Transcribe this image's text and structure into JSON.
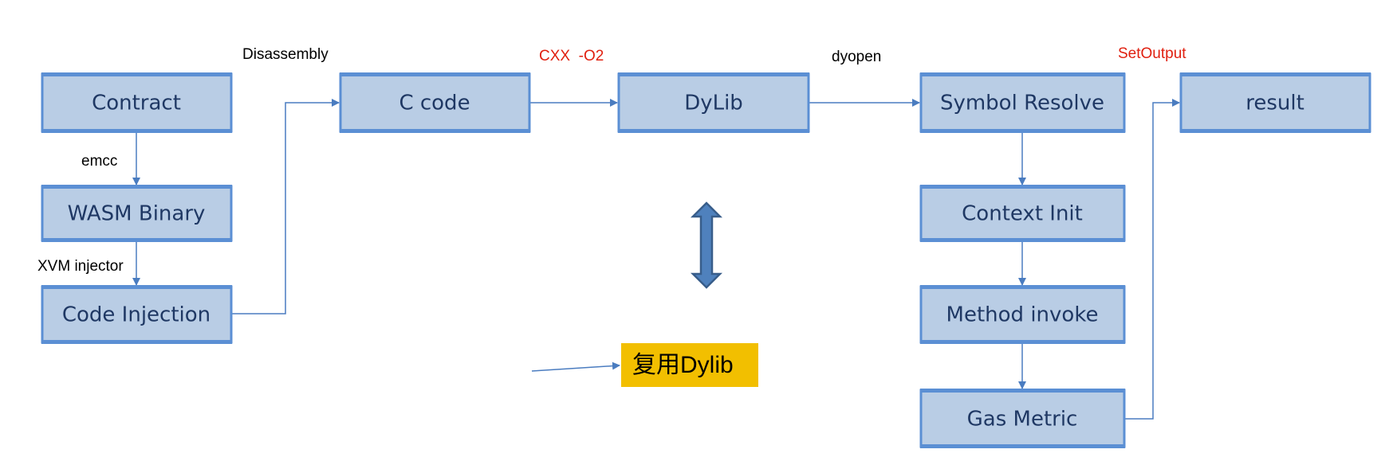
{
  "boxes": {
    "contract": "Contract",
    "wasm_binary": "WASM Binary",
    "code_injection": "Code Injection",
    "c_code": "C code",
    "dylib": "DyLib",
    "symbol_resolve": "Symbol Resolve",
    "result": "result",
    "context_init": "Context Init",
    "method_invoke": "Method invoke",
    "gas_metric": "Gas Metric"
  },
  "labels": {
    "disassembly": "Disassembly",
    "cxx_o2": "CXX  -O2",
    "dyopen": "dyopen",
    "set_output": "SetOutput",
    "emcc": "emcc",
    "xvm_injector": "XVM injector"
  },
  "note": "复用Dylib",
  "colors": {
    "box_fill": "#b9cde5",
    "box_border": "#5b8fd4",
    "text": "#1f3864",
    "accent_red": "#e02010",
    "note_bg": "#f2bf00",
    "double_arrow": "#4f81bd"
  }
}
